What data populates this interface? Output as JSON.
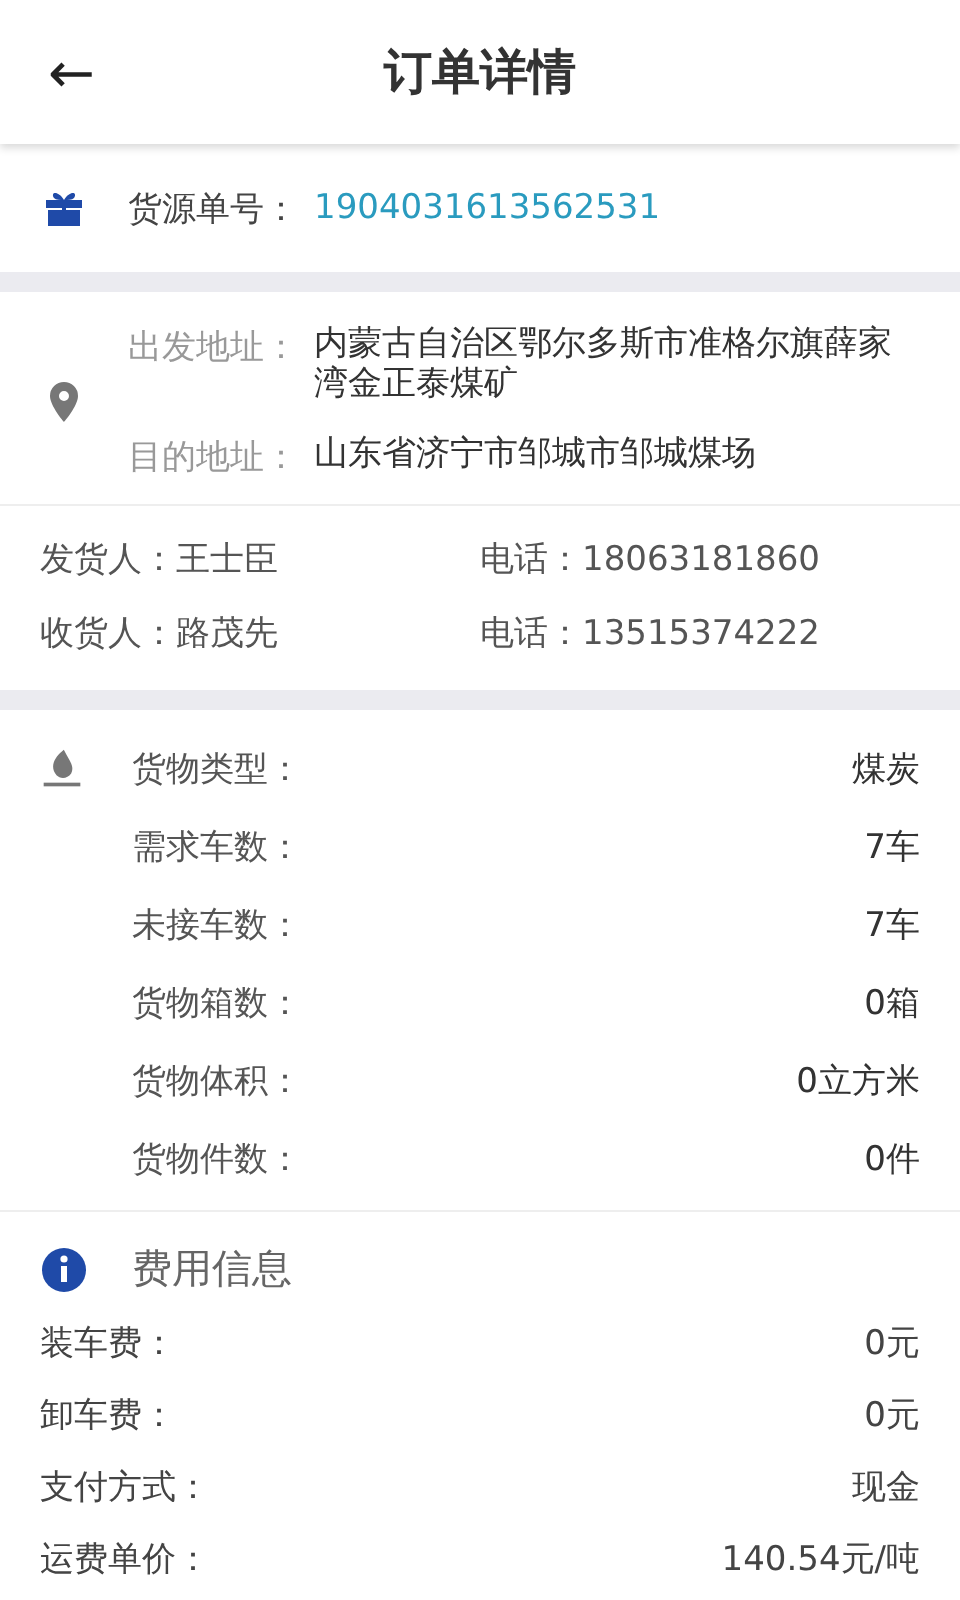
{
  "header": {
    "back": "←",
    "title": "订单详情"
  },
  "order": {
    "label": "货源单号：",
    "number": "1904031613562531"
  },
  "addresses": [
    {
      "label": "出发地址：",
      "value": "内蒙古自治区鄂尔多斯市准格尔旗薛家湾金正泰煤矿"
    },
    {
      "label": "目的地址：",
      "value": "山东省济宁市邹城市邹城煤场"
    }
  ],
  "people": [
    {
      "role": "发货人：",
      "name": "王士臣",
      "phone_label": "电话：",
      "phone": "18063181860"
    },
    {
      "role": "收货人：",
      "name": "路茂先",
      "phone_label": "电话：",
      "phone": "13515374222"
    }
  ],
  "cargo": [
    {
      "label": "货物类型：",
      "value": "煤炭"
    },
    {
      "label": "需求车数：",
      "value": "7车"
    },
    {
      "label": "未接车数：",
      "value": "7车"
    },
    {
      "label": "货物箱数：",
      "value": "0箱"
    },
    {
      "label": "货物体积：",
      "value": "0立方米"
    },
    {
      "label": "货物件数：",
      "value": "0件"
    }
  ],
  "fees": {
    "title": "费用信息",
    "rows": [
      {
        "label": "装车费：",
        "value": "0元"
      },
      {
        "label": "卸车费：",
        "value": "0元"
      },
      {
        "label": "支付方式：",
        "value": "现金"
      },
      {
        "label": "运费单价：",
        "value": "140.54元/吨"
      }
    ]
  }
}
